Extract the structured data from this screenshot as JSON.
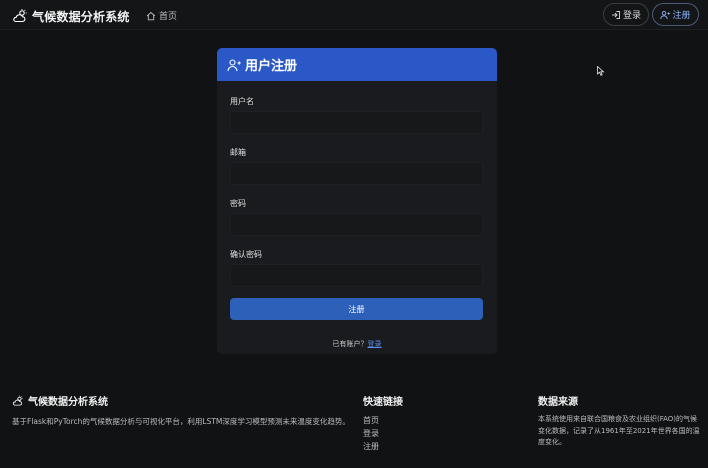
{
  "navbar": {
    "brand": "气候数据分析系统",
    "home": "首页",
    "login": "登录",
    "register": "注册"
  },
  "form": {
    "title": "用户注册",
    "username_label": "用户名",
    "email_label": "邮箱",
    "password_label": "密码",
    "confirm_label": "确认密码",
    "submit": "注册",
    "have_account": "已有账户？",
    "login_link": "登录"
  },
  "footer": {
    "brand": "气候数据分析系统",
    "description": "基于Flask和PyTorch的气候数据分析与可视化平台，利用LSTM深度学习模型预测未来温度变化趋势。",
    "quick_links_title": "快速链接",
    "links": [
      "首页",
      "登录",
      "注册"
    ],
    "source_title": "数据来源",
    "source_text": "本系统使用来自联合国粮食及农业组织(FAO)的气候变化数据，记录了从1961年至2021年世界各国的温度变化。"
  },
  "colors": {
    "background": "#111214",
    "card": "#1a1b1e",
    "header_accent": "#2a58c6",
    "button": "#2d60b8",
    "link": "#5a8ef0"
  },
  "icons": [
    "cloud-sun-icon",
    "home-icon",
    "login-icon",
    "user-plus-icon",
    "cursor-icon"
  ]
}
